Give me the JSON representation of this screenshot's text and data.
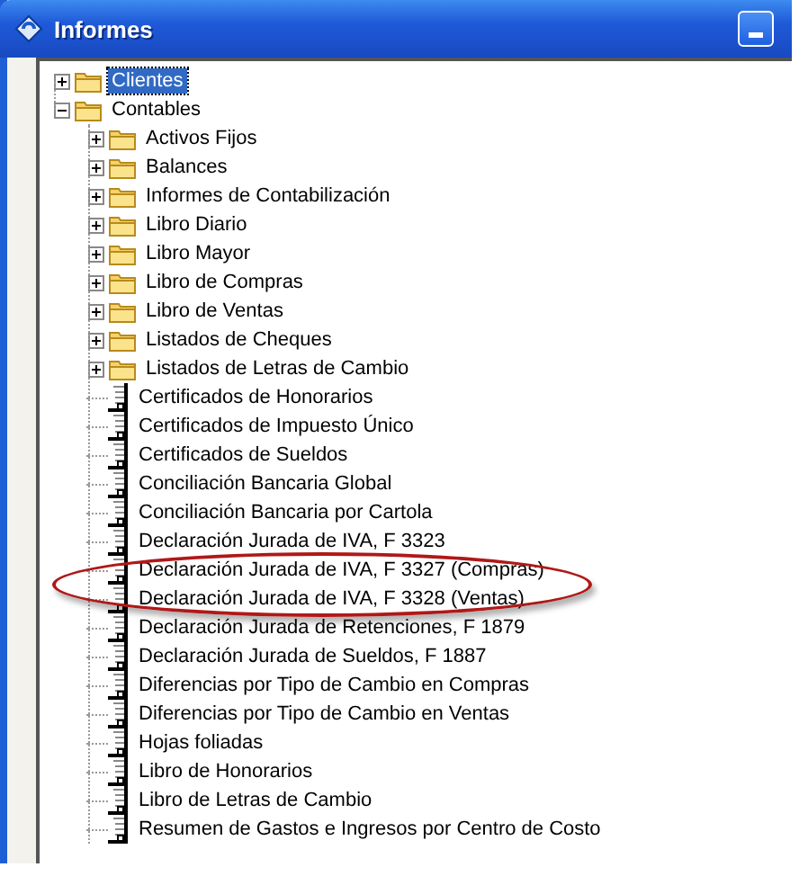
{
  "window": {
    "title": "Informes"
  },
  "tree": [
    {
      "label": "Clientes",
      "kind": "folder",
      "expanded": false,
      "selected": true
    },
    {
      "label": "Contables",
      "kind": "folder",
      "expanded": true,
      "selected": false,
      "children": [
        {
          "label": "Activos Fijos",
          "kind": "folder",
          "expanded": false,
          "selected": false,
          "circled": false
        },
        {
          "label": "Balances",
          "kind": "folder",
          "expanded": false,
          "selected": false,
          "circled": false
        },
        {
          "label": "Informes de Contabilización",
          "kind": "folder",
          "expanded": false,
          "selected": false,
          "circled": false
        },
        {
          "label": "Libro Diario",
          "kind": "folder",
          "expanded": false,
          "selected": false,
          "circled": false
        },
        {
          "label": "Libro Mayor",
          "kind": "folder",
          "expanded": false,
          "selected": false,
          "circled": false
        },
        {
          "label": "Libro de Compras",
          "kind": "folder",
          "expanded": false,
          "selected": false,
          "circled": false
        },
        {
          "label": "Libro de Ventas",
          "kind": "folder",
          "expanded": false,
          "selected": false,
          "circled": false
        },
        {
          "label": "Listados de Cheques",
          "kind": "folder",
          "expanded": false,
          "selected": false,
          "circled": false
        },
        {
          "label": "Listados de Letras de Cambio",
          "kind": "folder",
          "expanded": false,
          "selected": false,
          "circled": false
        },
        {
          "label": "Certificados de Honorarios",
          "kind": "report",
          "selected": false,
          "circled": false
        },
        {
          "label": "Certificados de Impuesto Único",
          "kind": "report",
          "selected": false,
          "circled": false
        },
        {
          "label": "Certificados de Sueldos",
          "kind": "report",
          "selected": false,
          "circled": false
        },
        {
          "label": "Conciliación Bancaria Global",
          "kind": "report",
          "selected": false,
          "circled": false
        },
        {
          "label": "Conciliación Bancaria por Cartola",
          "kind": "report",
          "selected": false,
          "circled": false
        },
        {
          "label": "Declaración Jurada de IVA, F 3323",
          "kind": "report",
          "selected": false,
          "circled": false
        },
        {
          "label": "Declaración Jurada de IVA, F 3327 (Compras)",
          "kind": "report",
          "selected": false,
          "circled": true
        },
        {
          "label": "Declaración Jurada de IVA, F 3328 (Ventas)",
          "kind": "report",
          "selected": false,
          "circled": true
        },
        {
          "label": "Declaración Jurada de Retenciones, F 1879",
          "kind": "report",
          "selected": false,
          "circled": false
        },
        {
          "label": "Declaración Jurada de Sueldos, F 1887",
          "kind": "report",
          "selected": false,
          "circled": false
        },
        {
          "label": "Diferencias por Tipo de Cambio en Compras",
          "kind": "report",
          "selected": false,
          "circled": false
        },
        {
          "label": "Diferencias por Tipo de Cambio en Ventas",
          "kind": "report",
          "selected": false,
          "circled": false
        },
        {
          "label": "Hojas foliadas",
          "kind": "report",
          "selected": false,
          "circled": false
        },
        {
          "label": "Libro de Honorarios",
          "kind": "report",
          "selected": false,
          "circled": false
        },
        {
          "label": "Libro de Letras de Cambio",
          "kind": "report",
          "selected": false,
          "circled": false
        },
        {
          "label": "Resumen de Gastos e Ingresos por Centro de Costo",
          "kind": "report",
          "selected": false,
          "circled": false
        }
      ]
    }
  ]
}
